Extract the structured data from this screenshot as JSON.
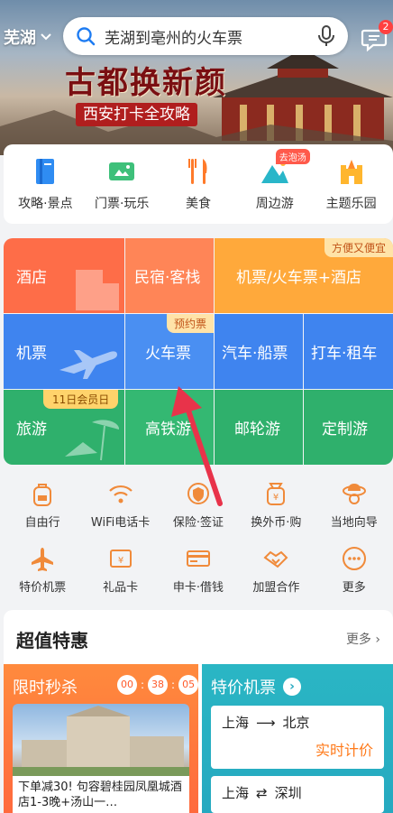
{
  "header": {
    "city": "芜湖",
    "search_placeholder": "芜湖到亳州的火车票",
    "message_badge": "2"
  },
  "banner": {
    "title": "古都换新颜",
    "subtitle": "西安打卡全攻略"
  },
  "quick_nav": [
    {
      "label": "攻略·景点",
      "icon": "guide-book-icon"
    },
    {
      "label": "门票·玩乐",
      "icon": "ticket-icon"
    },
    {
      "label": "美食",
      "icon": "fork-knife-icon"
    },
    {
      "label": "周边游",
      "icon": "mountain-icon",
      "tag": "去泡汤"
    },
    {
      "label": "主题乐园",
      "icon": "castle-icon"
    }
  ],
  "main_grid": {
    "hotel": "酒店",
    "homestay": "民宿·客栈",
    "flight_train_hotel": "机票/火车票+酒店",
    "flight_train_hotel_tag": "方便又便宜",
    "flight": "机票",
    "train": "火车票",
    "train_tag": "预约票",
    "bus_ship": "汽车·船票",
    "taxi_rental": "打车·租车",
    "travel": "旅游",
    "travel_tag": "11日会员日",
    "high_speed": "高铁游",
    "cruise": "邮轮游",
    "custom": "定制游"
  },
  "services": {
    "row1": [
      {
        "label": "自由行",
        "icon": "backpack-icon"
      },
      {
        "label": "WiFi电话卡",
        "icon": "wifi-icon"
      },
      {
        "label": "保险·签证",
        "icon": "shield-globe-icon"
      },
      {
        "label": "换外币·购",
        "icon": "currency-bag-icon"
      },
      {
        "label": "当地向导",
        "icon": "guide-hat-icon"
      }
    ],
    "row2": [
      {
        "label": "特价机票",
        "icon": "airplane-icon"
      },
      {
        "label": "礼品卡",
        "icon": "gift-card-icon"
      },
      {
        "label": "申卡·借钱",
        "icon": "credit-card-icon"
      },
      {
        "label": "加盟合作",
        "icon": "handshake-icon"
      },
      {
        "label": "更多",
        "icon": "more-dots-icon"
      }
    ]
  },
  "deals": {
    "title": "超值特惠",
    "more": "更多",
    "flash_sale": {
      "title": "限时秒杀",
      "hours": "00",
      "minutes": "38",
      "seconds": "05",
      "desc": "下单减30! 句容碧桂园凤凰城酒店1-3晚+汤山一…"
    },
    "cheap_flights": {
      "title": "特价机票",
      "routes": [
        {
          "from": "上海",
          "to": "北京",
          "price": "实时计价"
        },
        {
          "from": "上海",
          "to": "深圳"
        }
      ]
    }
  },
  "colors": {
    "hotel": "#fe7a4f",
    "homestay": "#fd8a5a",
    "flight_row": "#4a8cf2",
    "travel_row": "#32b66f",
    "accent": "#ff5a2a"
  }
}
